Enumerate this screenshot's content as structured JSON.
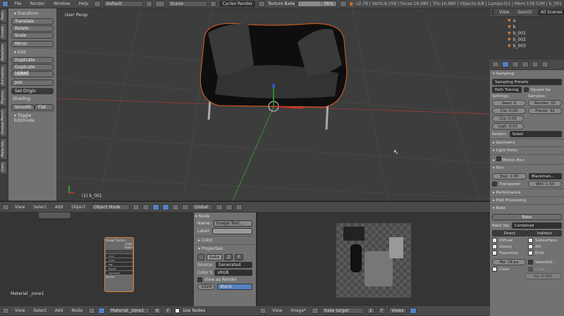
{
  "topbar": {
    "menus": [
      "File",
      "Render",
      "Window",
      "Help"
    ],
    "layout": "Default",
    "scene": "Scene",
    "engine": "Cycles Render",
    "job": "Texture Bake",
    "progress_percent": 56,
    "progress_label": "56%",
    "stats": "v2.79 | Verts:8,558 | Faces:16,980 | Tris:16,980 | Objects:4/8 | Lamps:0/1 | Mem:139.53M | b_001"
  },
  "toolshelf": {
    "tabs": [
      "Tools",
      "Create",
      "Relations",
      "Animation",
      "Physics",
      "Grease Pencil",
      "Materials",
      "Cam"
    ],
    "transform_title": "Transform",
    "transform": [
      "Translate",
      "Rotate",
      "Scale",
      "Mirror"
    ],
    "edit_title": "Edit",
    "edit": [
      "Duplicate",
      "Duplicate Linked",
      "Delete",
      "Join"
    ],
    "set_origin": "Set Origin",
    "shading_label": "Shading:",
    "smooth": "Smooth",
    "flat": "Flat",
    "toggle_editmode": "Toggle Editmode"
  },
  "viewport": {
    "label": "User Persp",
    "object_label": "(1) b_001"
  },
  "view3d_header": {
    "menus": [
      "View",
      "Select",
      "Add",
      "Object"
    ],
    "mode": "Object Mode",
    "layer": "Global"
  },
  "node_editor": {
    "node_title": "Image Texture",
    "outputs": [
      "Color",
      "Alpha"
    ],
    "fields": [
      "Color",
      "Linear",
      "Flat",
      "Repeat",
      "Generated"
    ],
    "input": "Vector",
    "top_node": "Image Texture",
    "material_label": "Material _zone1"
  },
  "node_panel": {
    "node_title": "Node",
    "name_label": "Name:",
    "name_value": "Image Text...",
    "label_label": "Label:",
    "color": "Color",
    "properties": "Properties",
    "image_name": "bake",
    "users": "2",
    "fake": "F",
    "source_label": "Source:",
    "source": "Generated",
    "colors_label": "Color S",
    "colorspace": "sRGB",
    "view_as_render": "View as Render",
    "size": "1024",
    "blank": "Blank"
  },
  "node_header": {
    "menus": [
      "View",
      "Select",
      "Add",
      "Node"
    ],
    "material": "Material _zone1",
    "users": "6",
    "fake": "F",
    "use_nodes": "Use Nodes"
  },
  "image_header": {
    "menus": [
      "View",
      "Image*"
    ],
    "image": "bake target",
    "users": "2",
    "fake": "F",
    "views": "Views"
  },
  "outliner": {
    "menus": [
      "View",
      "Search",
      "All Scenes"
    ],
    "items": [
      "a",
      "b",
      "b_001",
      "b_002",
      "b_003"
    ]
  },
  "properties": {
    "sampling": "Sampling",
    "presets": "Sampling Presets",
    "path": "Path Tracing",
    "square": "Square Sa",
    "settings": "Settings:",
    "samples": "Samples:",
    "seed": "Seed: 0",
    "clamp1": "Cla: 0.00",
    "clamp2": "Cla: 0.00",
    "light": "Ligh: 0.01",
    "render": "Render: 32",
    "preview": "Previe: 32",
    "pattern_label": "Pattern:",
    "pattern": "Sobol",
    "panels": [
      "Geometry",
      "Light Paths",
      "Motion Blur"
    ],
    "film": "Film",
    "exposure": "Exp: 1.00",
    "filter": "Blackman...",
    "transparent": "Transparen",
    "width": "Wid: 1.50",
    "performance": "Performance",
    "post": "Post Processing",
    "bake": "Bake",
    "bake_btn": "Bake",
    "bake_type_label": "Bake Typ",
    "bake_type": "Combined",
    "direct": "Direct",
    "indirect": "Indirect",
    "passes": [
      "Diffuse",
      "Subsurface",
      "Glossy",
      "AO",
      "Transmiss",
      "Emit"
    ],
    "margin": "Ma: 16 px",
    "selected": "Selected :",
    "clear": "Clear",
    "cage": "Cage",
    "ray": "Ra: 0.000"
  },
  "colors": {
    "accent": "#5680c2",
    "orange": "#e07020"
  }
}
